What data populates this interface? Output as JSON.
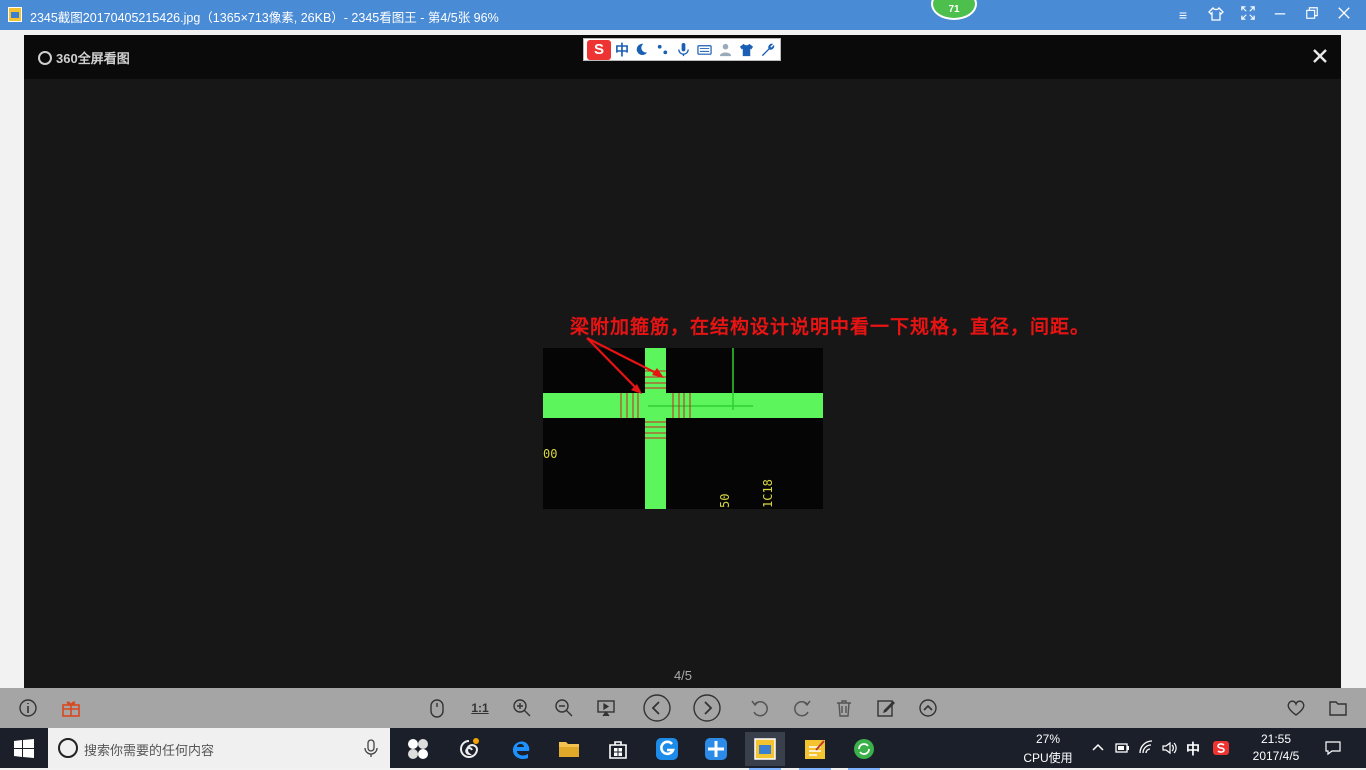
{
  "window": {
    "title": "2345截图20170405215426.jpg（1365×713像素, 26KB）- 2345看图王 - 第4/5张 96%",
    "badge": "71"
  },
  "viewer": {
    "brand": "360全屏看图",
    "ime_lang": "中",
    "ime_logo": "S",
    "annotation": "梁附加箍筋，在结构设计说明中看一下规格，直径，间距。",
    "cad_labels": {
      "left": "00",
      "mid": "50",
      "right": "1C18"
    },
    "page_counter": "4/5"
  },
  "toolbar": {
    "ratio_label": "1:1"
  },
  "taskbar": {
    "search_placeholder": "搜索你需要的任何内容",
    "cpu_percent": "27%",
    "cpu_label": "CPU使用",
    "ime_indicator": "中",
    "time": "21:55",
    "date": "2017/4/5"
  },
  "colors": {
    "titlebar": "#4a8bd6",
    "viewer_bg": "#171717",
    "annotation": "#e81313",
    "cad_green": "#5cf55c",
    "toolbar": "#a5a5a5",
    "taskbar": "#1b1f2a"
  }
}
